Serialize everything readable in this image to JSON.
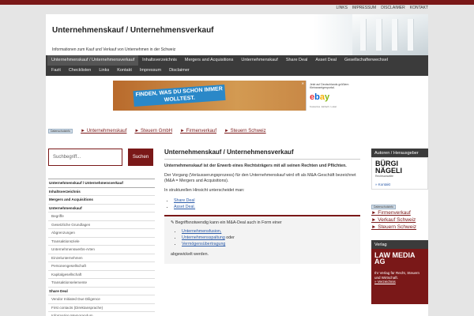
{
  "toplinks": [
    "LINKS",
    "IMPRESSUM",
    "DISCLAIMER",
    "KONTAKT"
  ],
  "header": {
    "title": "Unternehmenskauf / Unternehmensverkauf",
    "description": "Informationen zum Kauf und Verkauf von Unternehmen in der Schweiz"
  },
  "nav": {
    "row1": [
      "Unternehmenskauf / Unternehmensverkauf",
      "Inhaltsverzeichnis",
      "Mergers and Acquisitions",
      "Unternehmenskauf",
      "Share Deal",
      "Asset Deal",
      "Gesellschafterwechsel"
    ],
    "row2": [
      "Fazit",
      "Checklisten",
      "Links",
      "Kontakt",
      "Impressum",
      "Disclaimer"
    ]
  },
  "ad": {
    "banner": "FINDEN, WAS DU SCHON IMMER WOLLTEST.",
    "box_text": "Jetzt auf Deutschlands größtem Kleinanzeigenportal.",
    "logo": "ebay",
    "box_bottom": "Kostenlos. Einfach. Lokal."
  },
  "linkbar": {
    "badge": "Datenschutzinfo",
    "links": [
      "► Unternehmenskauf",
      "► Steuern GmbH",
      "► Firmenverkauf",
      "► Steuern Schweiz"
    ]
  },
  "search": {
    "placeholder": "Suchbegriff...",
    "button": "Suchen"
  },
  "sidebar": [
    {
      "label": "Unternehmenskauf / Unternehmensverkauf",
      "style": "bold top"
    },
    {
      "label": "Inhaltsverzeichnis",
      "style": "bold"
    },
    {
      "label": "Mergers and Acquisitions",
      "style": "bold"
    },
    {
      "label": "Unternehmenskauf",
      "style": "bold"
    },
    {
      "label": "Begriffe",
      "style": "sub"
    },
    {
      "label": "Gesetzliche Grundlagen",
      "style": "sub"
    },
    {
      "label": "Abgrenzungen",
      "style": "sub"
    },
    {
      "label": "Transaktionsziele",
      "style": "sub"
    },
    {
      "label": "Unternehmenswerbs-Arten",
      "style": "sub"
    },
    {
      "label": "Einzelunternehmen",
      "style": "sub"
    },
    {
      "label": "Personengesellschaft",
      "style": "sub"
    },
    {
      "label": "Kapitalgesellschaft",
      "style": "sub"
    },
    {
      "label": "Transaktionselemente",
      "style": "sub"
    },
    {
      "label": "Share Deal",
      "style": "bold"
    },
    {
      "label": "Vendor Initiated Due Diligence",
      "style": "sub"
    },
    {
      "label": "First contacts (Direktansprache)",
      "style": "sub"
    },
    {
      "label": "Information Memorandum",
      "style": "sub"
    },
    {
      "label": "Confidentiality-/exclusivity agreement",
      "style": "sub"
    }
  ],
  "main": {
    "title": "Unternehmenskauf / Unternehmensverkauf",
    "p1": "Unternehmenskauf ist der Erwerb eines Rechtsträgers mit all seinen Rechten und Pflichten.",
    "p2": "Der Vorgang (Veräusserungsprozess) für den Unternehmenskauf wird oft als M&A-Geschäft bezeichnet (M&A = Mergers and Acquisitions).",
    "p3": "In strukturellen Hinsicht unterscheidet man:",
    "list": [
      "Share Deal",
      "Asset Deal."
    ],
    "callout_intro": "Begriffsnotwendig kann ein M&A-Deal auch in Form einer",
    "callout_list": [
      "Unternehmensfusion,",
      "Unternehmensspaltung",
      "Vermögensübertragung"
    ],
    "callout_oder": " oder",
    "callout_end": "abgewickelt werden."
  },
  "rside": {
    "authors_head": "Autoren / Herausgeber",
    "buergi_logo": "BÜRGI NÄGELI",
    "buergi_sub": "Rechtsanwälte",
    "kontakt": "» Kontakt",
    "badge": "Datenschutzinfo",
    "links": [
      "► Firmenverkauf",
      "► Verkauf Schweiz",
      "► Steuern Schweiz"
    ],
    "verlag_head": "Verlag",
    "law_logo": "LAW MEDIA AG",
    "law_desc": "Ihr Verlag für Recht, Steuern und Wirtschaft.",
    "law_link": "» Verzeichnis"
  }
}
